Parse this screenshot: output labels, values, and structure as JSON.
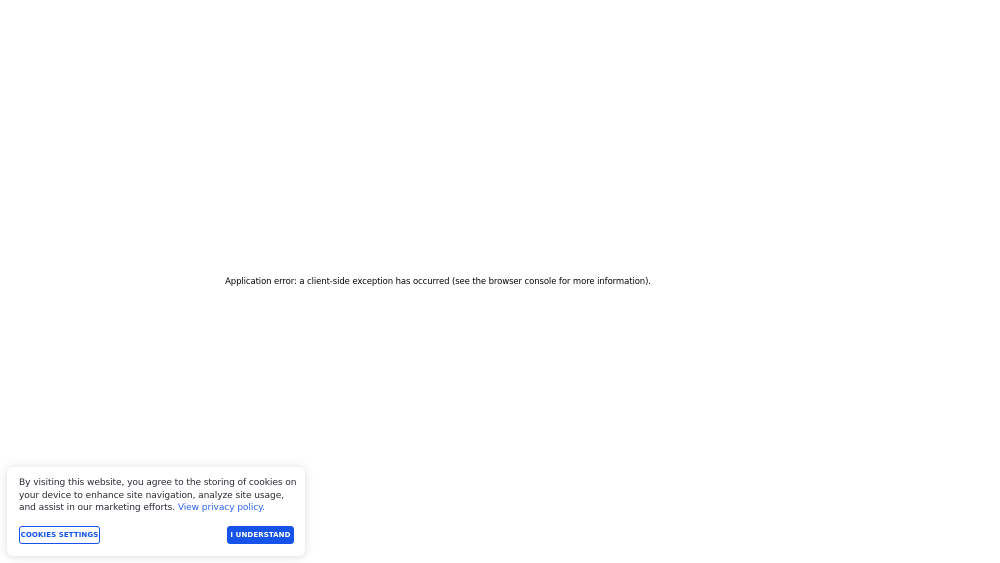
{
  "error": {
    "message": "Application error: a client-side exception has occurred (see the browser console for more information)."
  },
  "cookie_banner": {
    "text": "By visiting this website, you agree to the storing of cookies on your device to enhance site navigation, analyze site usage, and assist in our marketing efforts.",
    "privacy_link": "View privacy policy.",
    "settings_button": "COOKIES SETTINGS",
    "accept_button": "I UNDERSTAND",
    "colors": {
      "accent": "#1553ea",
      "link": "#2f66f2",
      "text": "#2b2b35"
    }
  }
}
